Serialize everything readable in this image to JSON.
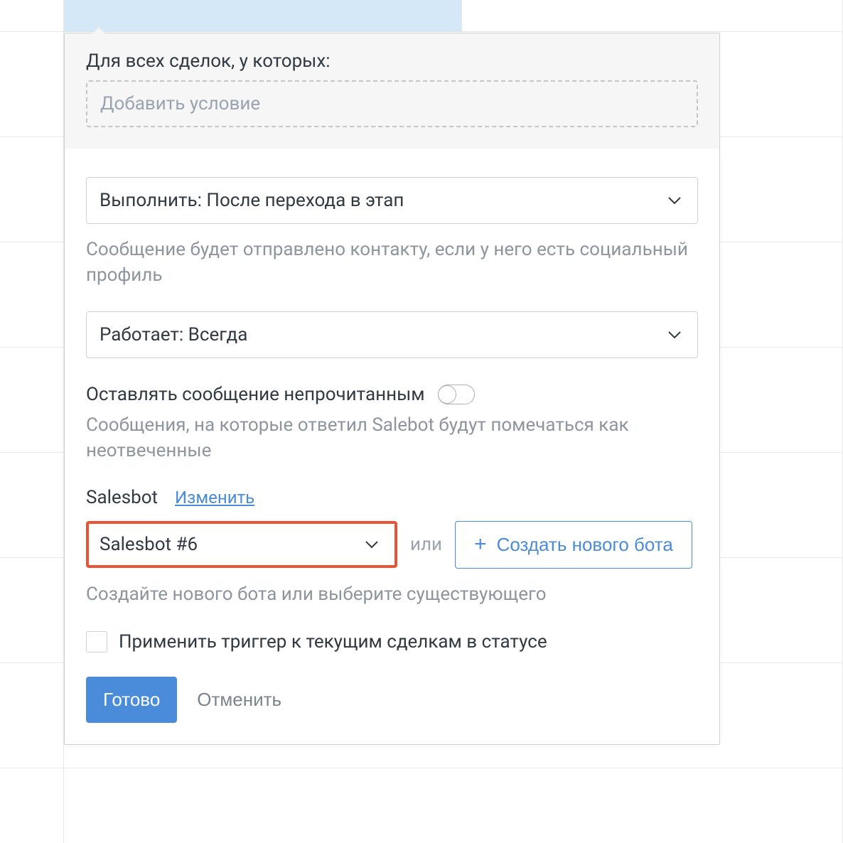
{
  "condition": {
    "title": "Для всех сделок, у которых:",
    "placeholder": "Добавить условие"
  },
  "execute": {
    "label": "Выполнить: После перехода в этап",
    "helper": "Сообщение будет отправлено контакту, если у него есть социальный профиль"
  },
  "schedule": {
    "label": "Работает: Всегда"
  },
  "unread": {
    "label": "Оставлять сообщение непрочитанным",
    "helper": "Сообщения, на которые ответил Salebot будут помечаться как неотвеченные"
  },
  "salesbot": {
    "title": "Salesbot",
    "edit": "Изменить",
    "selected": "Salesbot #6",
    "or": "или",
    "create": "Создать нового бота",
    "helper": "Создайте нового бота или выберите существующего"
  },
  "applyTrigger": {
    "label": "Применить триггер к текущим сделкам в статусе"
  },
  "actions": {
    "done": "Готово",
    "cancel": "Отменить"
  }
}
